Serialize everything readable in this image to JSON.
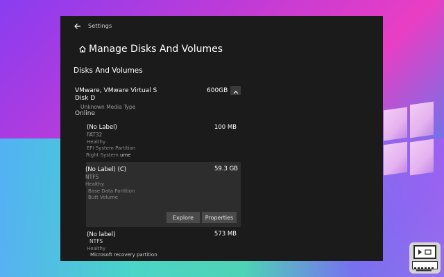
{
  "window": {
    "title": "Settings",
    "page_title": "Manage Disks And Volumes",
    "section_title": "Disks And Volumes"
  },
  "disk": {
    "name": "VMware, VMware Virtual S",
    "label": "Disk D",
    "media_type": "Unknown Media Type",
    "status": "Online",
    "size": "600GB"
  },
  "partitions": [
    {
      "name": "(No Label)",
      "filesystem": "FAT32",
      "health": "Healthy",
      "type": "EFI System Partition",
      "extra": "Right System",
      "extra2": "ume",
      "size": "100 MB"
    },
    {
      "name": "(No Label) (C)",
      "filesystem": "NTFS",
      "health": "Healthy",
      "type": "Base Data Partition",
      "extra": "Butt Volume",
      "size": "59.3 GB",
      "buttons": {
        "explore": "Explore",
        "properties": "Properties"
      }
    },
    {
      "name": "(No label)",
      "filesystem": "NTFS",
      "health": "Healthy",
      "type": "Microsoft recovery partition",
      "size": "573 MB"
    }
  ],
  "icons": {
    "back": "back-arrow-icon",
    "home": "home-icon",
    "collapse": "chevron-up-icon",
    "logo": "windows-logo-icon",
    "badge": "site-badge-icon"
  },
  "colors": {
    "window_bg": "#1b1b1b",
    "selected_partition_bg": "#2d2d2d",
    "button_bg": "#4a4a4a",
    "primary_text": "#ffffff",
    "secondary_text": "#9b9b9b"
  }
}
